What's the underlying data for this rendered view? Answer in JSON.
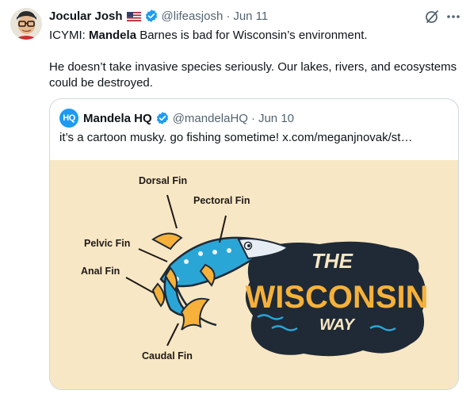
{
  "author": {
    "name": "Jocular Josh",
    "handle": "@lifeasjosh",
    "separator": "·",
    "date": "Jun 11",
    "flag_icon": "us-flag-icon",
    "verified_icon": "verified-badge-icon",
    "verified_color": "#1d9bf0"
  },
  "tweet": {
    "prefix": "ICYMI: ",
    "mention": "Mandela",
    "line1_rest": " Barnes is bad for Wisconsin’s environment.",
    "paragraph2": "He doesn’t take invasive species seriously. Our lakes, rivers, and ecosystems could be destroyed."
  },
  "quoted": {
    "avatar_text": "HQ",
    "name": "Mandela HQ",
    "handle": "@mandelaHQ",
    "separator": "·",
    "date": "Jun 10",
    "text": "it’s a cartoon musky. go fishing sometime!  ",
    "link": "x.com/meganjnovak/st…"
  },
  "image": {
    "labels": {
      "dorsal": "Dorsal Fin",
      "pectoral": "Pectoral Fin",
      "pelvic": "Pelvic Fin",
      "anal": "Anal Fin",
      "caudal": "Caudal Fin"
    },
    "logo_the": "THE",
    "logo_main": "WISCONSIN",
    "logo_way": "WAY"
  },
  "colors": {
    "accent": "#1d9bf0",
    "background_image": "#f8e7c4",
    "logo_yellow": "#f6b13a",
    "logo_dark": "#1f2a36",
    "fish_blue": "#2aa6d6"
  }
}
